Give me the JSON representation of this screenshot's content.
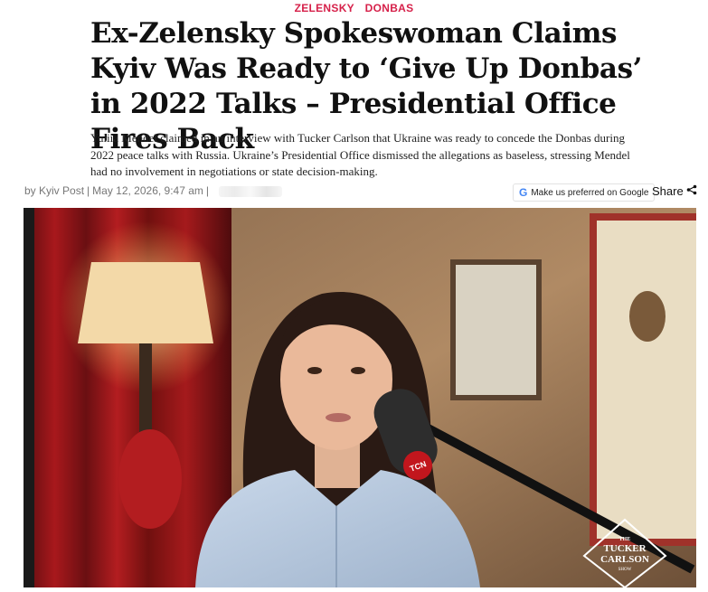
{
  "tags": [
    "ZELENSKY",
    "DONBAS"
  ],
  "headline": "Ex-Zelensky Spokeswoman Claims Kyiv Was Ready to ‘Give Up Donbas’ in 2022 Talks – Presidential Office Fires Back",
  "summary": "Yuliia Mendel claimed in an interview with Tucker Carlson that Ukraine was ready to concede the Donbas during 2022 peace talks with Russia. Ukraine’s Presidential Office dismissed the allegations as baseless, stressing Mendel had no involvement in negotiations or state decision-making.",
  "byline": {
    "author": "by Kyiv Post",
    "date": "May 12, 2026, 9:47 am"
  },
  "google_preferred": {
    "icon": "google-g-icon",
    "label": "Make us preferred on Google"
  },
  "share": {
    "label": "Share",
    "icon": "share-icon"
  },
  "image": {
    "mic_logo": "TCN",
    "watermark": [
      "THE",
      "TUCKER",
      "CARLSON",
      "SHOW"
    ]
  },
  "colors": {
    "tag": "#d6214a",
    "headline": "#111111",
    "byline": "#777777"
  }
}
